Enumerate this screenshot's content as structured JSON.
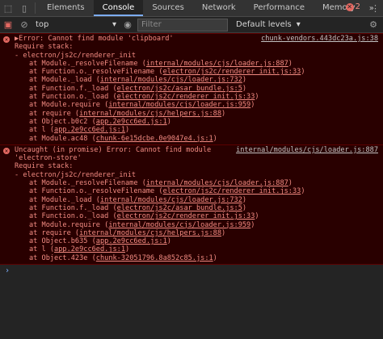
{
  "tabs": [
    "Elements",
    "Console",
    "Sources",
    "Network",
    "Performance",
    "Memory"
  ],
  "more_tabs": "»",
  "error_count": "2",
  "toolbar": {
    "context": "top",
    "filter_placeholder": "Filter",
    "levels": "Default levels"
  },
  "messages": [
    {
      "source": "chunk-vendors.443dc23a.js:38",
      "lines": [
        {
          "text": "▶Error: Cannot find module 'clipboard'"
        },
        {
          "text": "Require stack:"
        },
        {
          "text": "- electron/js2c/renderer_init"
        },
        {
          "pre": "at Module._resolveFilename (",
          "link": "internal/modules/cjs/loader.js:887",
          "post": ")"
        },
        {
          "pre": "at Function.o._resolveFilename (",
          "link": "electron/js2c/renderer_init.js:33",
          "post": ")"
        },
        {
          "pre": "at Module._load (",
          "link": "internal/modules/cjs/loader.js:732",
          "post": ")"
        },
        {
          "pre": "at Function.f._load (",
          "link": "electron/js2c/asar_bundle.js:5",
          "post": ")"
        },
        {
          "pre": "at Function.o._load (",
          "link": "electron/js2c/renderer_init.js:33",
          "post": ")"
        },
        {
          "pre": "at Module.require (",
          "link": "internal/modules/cjs/loader.js:959",
          "post": ")"
        },
        {
          "pre": "at require (",
          "link": "internal/modules/cjs/helpers.js:88",
          "post": ")"
        },
        {
          "pre": "at Object.b0c2 (",
          "link": "app.2e9cc6ed.js:1",
          "post": ")"
        },
        {
          "pre": "at l (",
          "link": "app.2e9cc6ed.js:1",
          "post": ")"
        },
        {
          "pre": "at Module.ac48 (",
          "link": "chunk-6e15dcbe.0e9047e4.js:1",
          "post": ")"
        }
      ]
    },
    {
      "source": "internal/modules/cjs/loader.js:887",
      "lines": [
        {
          "text": "Uncaught (in promise) Error: Cannot find module"
        },
        {
          "text": "'electron-store'"
        },
        {
          "text": "Require stack:"
        },
        {
          "text": "- electron/js2c/renderer_init"
        },
        {
          "pre": "at Module._resolveFilename (",
          "link": "internal/modules/cjs/loader.js:887",
          "post": ")"
        },
        {
          "pre": "at Function.o._resolveFilename (",
          "link": "electron/js2c/renderer_init.js:33",
          "post": ")"
        },
        {
          "pre": "at Module._load (",
          "link": "internal/modules/cjs/loader.js:732",
          "post": ")"
        },
        {
          "pre": "at Function.f._load (",
          "link": "electron/js2c/asar_bundle.js:5",
          "post": ")"
        },
        {
          "pre": "at Function.o._load (",
          "link": "electron/js2c/renderer_init.js:33",
          "post": ")"
        },
        {
          "pre": "at Module.require (",
          "link": "internal/modules/cjs/loader.js:959",
          "post": ")"
        },
        {
          "pre": "at require (",
          "link": "internal/modules/cjs/helpers.js:88",
          "post": ")"
        },
        {
          "pre": "at Object.b635 (",
          "link": "app.2e9cc6ed.js:1",
          "post": ")"
        },
        {
          "pre": "at l (",
          "link": "app.2e9cc6ed.js:1",
          "post": ")"
        },
        {
          "pre": "at Object.423e (",
          "link": "chunk-32051796.8a852c85.js:1",
          "post": ")"
        }
      ]
    }
  ],
  "prompt_symbol": "›"
}
